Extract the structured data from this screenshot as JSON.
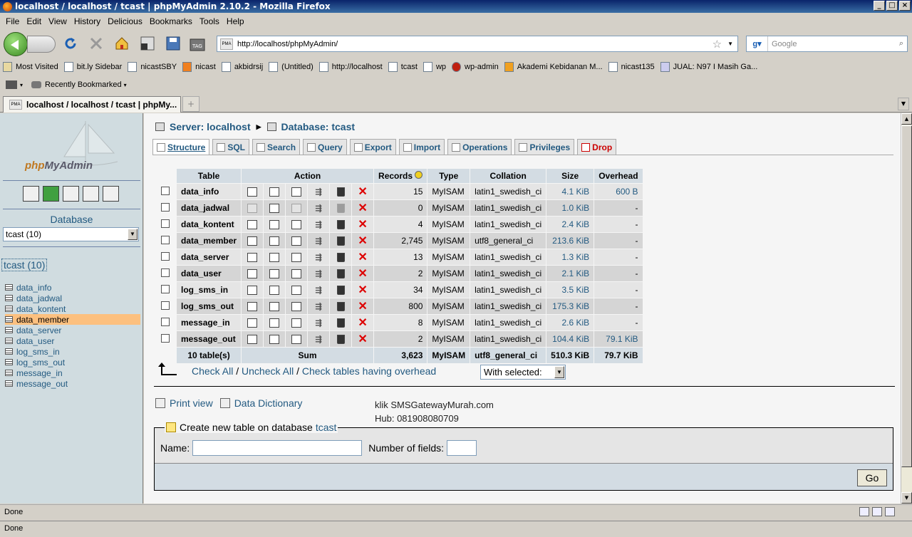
{
  "window": {
    "title": "localhost / localhost / tcast | phpMyAdmin 2.10.2 - Mozilla Firefox"
  },
  "menu": [
    "File",
    "Edit",
    "View",
    "History",
    "Delicious",
    "Bookmarks",
    "Tools",
    "Help"
  ],
  "nav": {
    "url": "http://localhost/phpMyAdmin/",
    "search_placeholder": "Google"
  },
  "bookmarks": [
    "Most Visited",
    "bit.ly Sidebar",
    "nicastSBY",
    "nicast",
    "akbidrsij",
    "(Untitled)",
    "http://localhost",
    "tcast",
    "wp",
    "wp-admin",
    "Akademi Kebidanan M...",
    "nicast135",
    "JUAL: N97 I Masih Ga..."
  ],
  "bookmarks2": {
    "recent": "Recently Bookmarked"
  },
  "tab": {
    "label": "localhost / localhost / tcast | phpMy..."
  },
  "left": {
    "logo_a": "php",
    "logo_b": "MyAdmin",
    "db_label": "Database",
    "db_select": "tcast (10)",
    "db_name": "tcast (10)",
    "tables": [
      "data_info",
      "data_jadwal",
      "data_kontent",
      "data_member",
      "data_server",
      "data_user",
      "log_sms_in",
      "log_sms_out",
      "message_in",
      "message_out"
    ]
  },
  "main": {
    "server": "Server: localhost",
    "database": "Database: tcast",
    "tabs": [
      "Structure",
      "SQL",
      "Search",
      "Query",
      "Export",
      "Import",
      "Operations",
      "Privileges",
      "Drop"
    ],
    "headers": {
      "table": "Table",
      "action": "Action",
      "records": "Records",
      "type": "Type",
      "collation": "Collation",
      "size": "Size",
      "overhead": "Overhead"
    },
    "rows": [
      {
        "name": "data_info",
        "records": "15",
        "type": "MyISAM",
        "collation": "latin1_swedish_ci",
        "size": "4.1 KiB",
        "overhead": "600 B"
      },
      {
        "name": "data_jadwal",
        "records": "0",
        "type": "MyISAM",
        "collation": "latin1_swedish_ci",
        "size": "1.0 KiB",
        "overhead": "-"
      },
      {
        "name": "data_kontent",
        "records": "4",
        "type": "MyISAM",
        "collation": "latin1_swedish_ci",
        "size": "2.4 KiB",
        "overhead": "-"
      },
      {
        "name": "data_member",
        "records": "2,745",
        "type": "MyISAM",
        "collation": "utf8_general_ci",
        "size": "213.6 KiB",
        "overhead": "-"
      },
      {
        "name": "data_server",
        "records": "13",
        "type": "MyISAM",
        "collation": "latin1_swedish_ci",
        "size": "1.3 KiB",
        "overhead": "-"
      },
      {
        "name": "data_user",
        "records": "2",
        "type": "MyISAM",
        "collation": "latin1_swedish_ci",
        "size": "2.1 KiB",
        "overhead": "-"
      },
      {
        "name": "log_sms_in",
        "records": "34",
        "type": "MyISAM",
        "collation": "latin1_swedish_ci",
        "size": "3.5 KiB",
        "overhead": "-"
      },
      {
        "name": "log_sms_out",
        "records": "800",
        "type": "MyISAM",
        "collation": "latin1_swedish_ci",
        "size": "175.3 KiB",
        "overhead": "-"
      },
      {
        "name": "message_in",
        "records": "8",
        "type": "MyISAM",
        "collation": "latin1_swedish_ci",
        "size": "2.6 KiB",
        "overhead": "-"
      },
      {
        "name": "message_out",
        "records": "2",
        "type": "MyISAM",
        "collation": "latin1_swedish_ci",
        "size": "104.4 KiB",
        "overhead": "79.1 KiB"
      }
    ],
    "sum": {
      "tables": "10 table(s)",
      "label": "Sum",
      "records": "3,623",
      "type": "MyISAM",
      "collation": "utf8_general_ci",
      "size": "510.3 KiB",
      "overhead": "79.7 KiB"
    },
    "check_all": "Check All",
    "uncheck_all": "Uncheck All",
    "check_overhead": "Check tables having overhead",
    "sep": " / ",
    "with_selected": "With selected:",
    "print_view": "Print view",
    "data_dictionary": "Data Dictionary",
    "klik": "klik SMSGatewayMurah.com",
    "hub": "Hub: 081908080709",
    "create_legend": "Create new table on database",
    "create_db": "tcast",
    "name_label": "Name:",
    "fields_label": "Number of fields:",
    "go": "Go"
  },
  "status": {
    "line1": "Done",
    "line2": "Done"
  }
}
